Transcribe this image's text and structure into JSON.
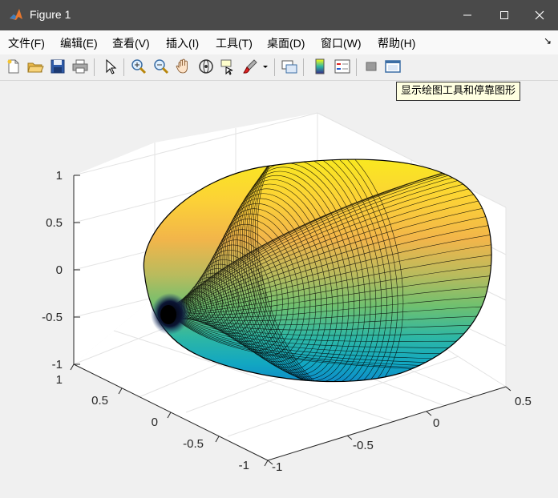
{
  "window": {
    "title": "Figure 1"
  },
  "menu": [
    "文件(F)",
    "编辑(E)",
    "查看(V)",
    "插入(I)",
    "工具(T)",
    "桌面(D)",
    "窗口(W)",
    "帮助(H)"
  ],
  "toolbar": {
    "tools": [
      {
        "name": "new-figure-icon"
      },
      {
        "name": "open-file-icon"
      },
      {
        "name": "save-icon"
      },
      {
        "name": "print-icon"
      },
      {
        "name": "edit-plot-arrow-icon"
      },
      {
        "name": "zoom-in-icon"
      },
      {
        "name": "zoom-out-icon"
      },
      {
        "name": "pan-hand-icon"
      },
      {
        "name": "rotate-3d-icon"
      },
      {
        "name": "data-cursor-icon"
      },
      {
        "name": "brush-icon"
      },
      {
        "name": "link-plot-icon"
      },
      {
        "name": "colorbar-icon"
      },
      {
        "name": "legend-icon"
      },
      {
        "name": "hide-plot-tools-icon"
      },
      {
        "name": "show-plot-tools-icon"
      }
    ],
    "tooltip": "显示绘图工具和停靠图形"
  },
  "plot": {
    "type": "surface",
    "surface_description": "ellipsoid-like closed surface with parula colormap",
    "colormap_colors": [
      "#352a87",
      "#0f5cdd",
      "#1481d6",
      "#06a4ca",
      "#2eb7a4",
      "#87bf77",
      "#d1bb59",
      "#fec832",
      "#f9fb0e"
    ],
    "z_ticks": [
      "1",
      "0.5",
      "0",
      "-0.5",
      "-1"
    ],
    "x_ticks": [
      "1",
      "0.5",
      "0",
      "-0.5",
      "-1"
    ],
    "y_ticks": [
      "-1",
      "-0.5",
      "0",
      "0.5"
    ],
    "grid": true
  }
}
